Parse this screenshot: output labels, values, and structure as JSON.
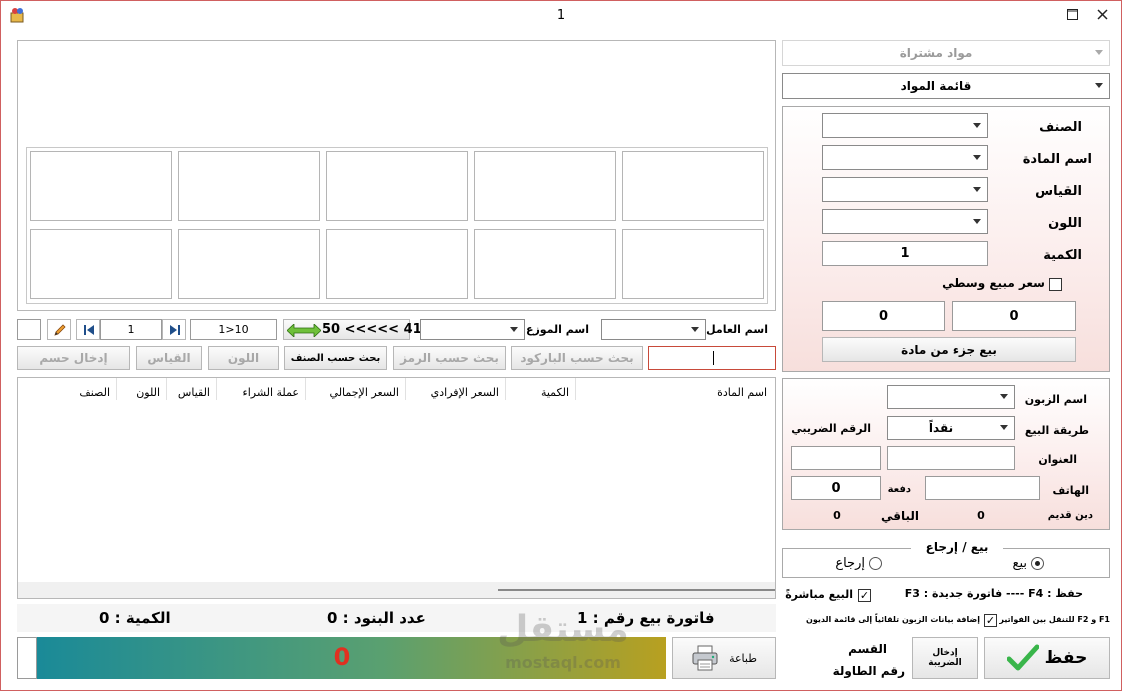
{
  "window": {
    "title": "1"
  },
  "top": {
    "purchased_combo": "مواد مشتراة",
    "materials_list_combo": "قائمة المواد"
  },
  "product_form": {
    "category_label": "الصنف",
    "material_name_label": "اسم المادة",
    "size_label": "القياس",
    "color_label": "اللون",
    "quantity_label": "الكمية",
    "quantity_value": "1",
    "mid_price_label": "سعر مبيع وسطي",
    "value_left": "0",
    "value_right": "0",
    "sell_part_button": "بيع جزء من مادة"
  },
  "customer_form": {
    "customer_name_label": "اسم الزبون",
    "payment_method_label": "طريقة البيع",
    "payment_method_value": "نقداً",
    "tax_number_label": "الرقم الضريبي",
    "address_label": "العنوان",
    "phone_label": "الهاتف",
    "payment_label": "دفعة",
    "payment_value": "0",
    "old_debt_label": "دين قديم",
    "old_debt_value": "0",
    "remaining_label": "الباقي",
    "remaining_value": "0"
  },
  "sale_return": {
    "group_label": "بيع / إرجاع",
    "sale_label": "بيع",
    "return_label": "إرجاع"
  },
  "options": {
    "shortcuts_text": "F3 : فاتورة جديدة ---- F4 : حفظ",
    "direct_sale_label": "البيع مباشرةً",
    "auto_customer_label": "إضافة بيانات الزبون تلقائياً إلى قائمة الديون",
    "nav_hint": "F1 و F2 للتنقل بين الفواتير"
  },
  "toolbar": {
    "worker_label": "اسم العامل",
    "distributor_label": "اسم الموزع",
    "counter_text": "50 <<<<< 41",
    "range_text": "1>10",
    "page_value": "1"
  },
  "search_buttons": {
    "by_barcode": "بحث حسب الباركود",
    "by_code": "بحث حسب الرمز",
    "by_category": "بحث حسب الصنف",
    "color": "اللون",
    "size": "القياس",
    "discount": "إدخال حسم"
  },
  "table": {
    "columns": [
      "اسم المادة",
      "الكمية",
      "السعر الإفرادي",
      "السعر الإجمالي",
      "عملة الشراء",
      "القياس",
      "اللون",
      "الصنف"
    ]
  },
  "summary": {
    "invoice_label": "فاتورة بيع رقم : 1",
    "items_label": "عدد البنود : 0",
    "quantity_label": "الكمية : 0",
    "total_value": "0"
  },
  "footer": {
    "print_button": "طباعة",
    "section_label": "القسم",
    "table_number_label": "رقم الطاولة",
    "enter_tax_button_line1": "إدخال",
    "enter_tax_button_line2": "الضريبة",
    "save_button": "حفظ"
  },
  "watermark": {
    "logo_text": "مستقل",
    "url_text": "mostaql.com"
  },
  "colors": {
    "accent_border": "#d06060",
    "total_fg": "#e03020",
    "save_check": "#39b54a"
  }
}
